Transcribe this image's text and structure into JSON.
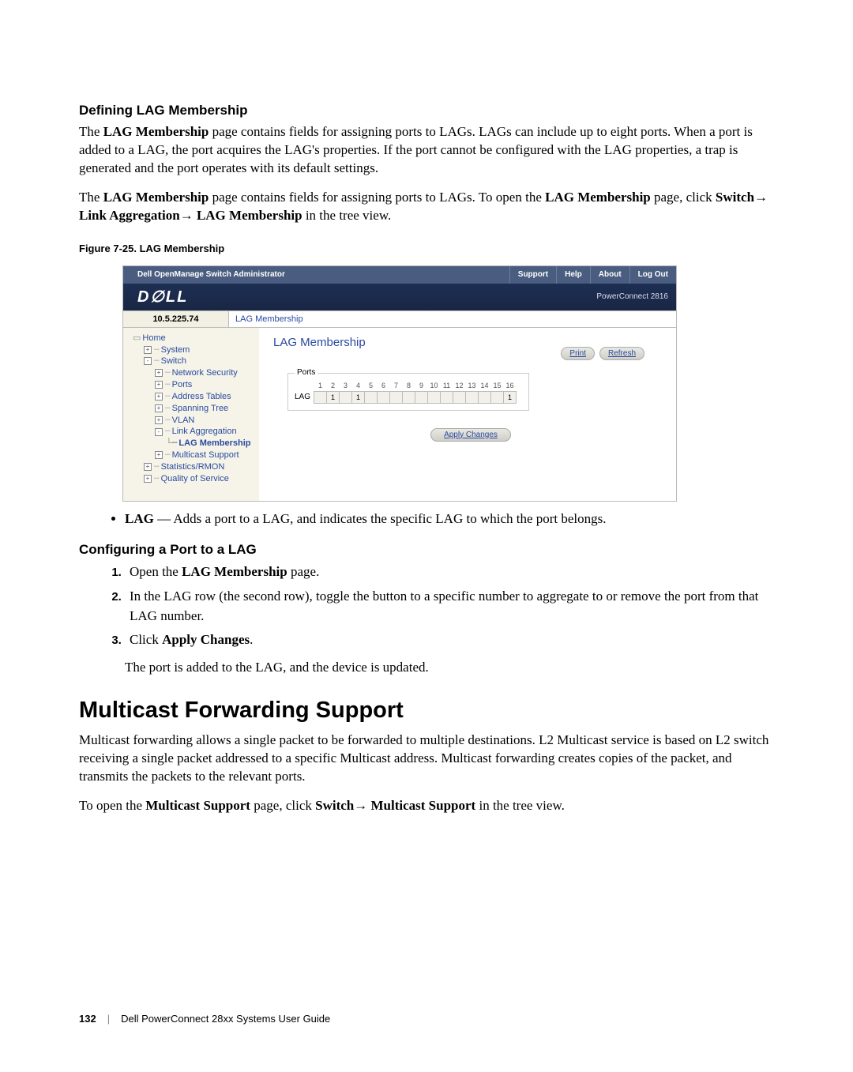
{
  "section1": {
    "heading": "Defining LAG Membership",
    "p1a": "The ",
    "p1b": "LAG Membership",
    "p1c": " page contains fields for assigning ports to LAGs. LAGs can include up to eight ports. When a port is added to a LAG, the port acquires the LAG's properties. If the port cannot be configured with the LAG properties, a trap is generated and the port operates with its default settings.",
    "p2a": "The ",
    "p2b": "LAG Membership",
    "p2c": " page contains fields for assigning ports to LAGs. To open the ",
    "p2d": "LAG Membership",
    "p2e": " page, click ",
    "p2f": "Switch",
    "p2arrow1": "→ ",
    "p2g": "Link Aggregation",
    "p2arrow2": "→ ",
    "p2h": "LAG Membership",
    "p2i": " in the tree view."
  },
  "figure": {
    "caption": "Figure 7-25.    LAG Membership",
    "top_title": "Dell OpenManage Switch Administrator",
    "tabs": [
      "Support",
      "Help",
      "About",
      "Log Out"
    ],
    "logo": "D∅LL",
    "product": "PowerConnect 2816",
    "ip": "10.5.225.74",
    "crumb": "LAG Membership",
    "tree": {
      "home": "Home",
      "system": "System",
      "switch": "Switch",
      "net": "Network Security",
      "ports": "Ports",
      "addr": "Address Tables",
      "span": "Spanning Tree",
      "vlan": "VLAN",
      "lagg": "Link Aggregation",
      "lagm": "LAG Membership",
      "mcast": "Multicast Support",
      "stats": "Statistics/RMON",
      "qos": "Quality of Service"
    },
    "main_title": "LAG Membership",
    "print": "Print",
    "refresh": "Refresh",
    "ports_legend": "Ports",
    "lag_label": "LAG",
    "headers": [
      "1",
      "2",
      "3",
      "4",
      "5",
      "6",
      "7",
      "8",
      "9",
      "10",
      "11",
      "12",
      "13",
      "14",
      "15",
      "16"
    ],
    "values": [
      "",
      "1",
      "",
      "1",
      "",
      "",
      "",
      "",
      "",
      "",
      "",
      "",
      "",
      "",
      "",
      "1"
    ],
    "apply": "Apply Changes"
  },
  "bullet": {
    "term": "LAG",
    "rest": " — Adds a port to a LAG, and indicates the specific LAG to which the port belongs."
  },
  "section2": {
    "heading": "Configuring a Port to a LAG",
    "s1a": "Open the ",
    "s1b": "LAG Membership",
    "s1c": " page.",
    "s2": "In the LAG row (the second row), toggle the button to a specific number to aggregate to or remove the port from that LAG number.",
    "s3a": "Click ",
    "s3b": "Apply Changes",
    "s3c": ".",
    "after": "The port is added to the LAG, and the device is updated."
  },
  "section3": {
    "heading": "Multicast Forwarding Support",
    "p1": "Multicast forwarding allows a single packet to be forwarded to multiple destinations. L2 Multicast service is based on L2 switch receiving a single packet addressed to a specific Multicast address. Multicast forwarding creates copies of the packet, and transmits the packets to the relevant ports.",
    "p2a": "To open the ",
    "p2b": "Multicast Support",
    "p2c": " page, click ",
    "p2d": "Switch",
    "p2arrow": "→ ",
    "p2e": "Multicast Support",
    "p2f": " in the tree view."
  },
  "footer": {
    "page": "132",
    "sep": "|",
    "guide": "Dell PowerConnect 28xx Systems User Guide"
  }
}
